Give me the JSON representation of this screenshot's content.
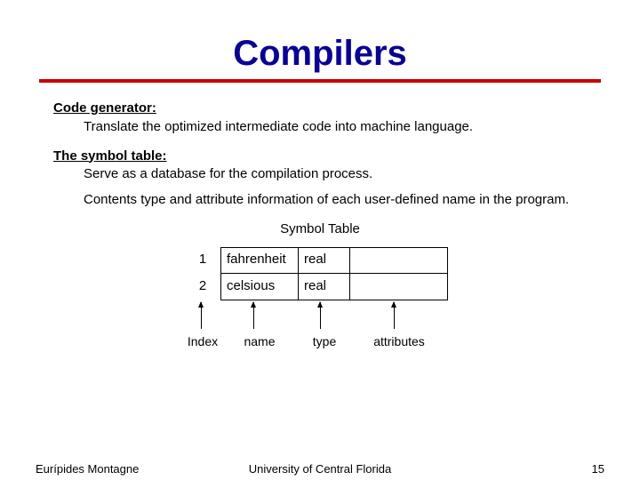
{
  "title": "Compilers",
  "sections": {
    "codegen": {
      "head": "Code generator:",
      "body": "Translate the optimized intermediate code into machine language."
    },
    "symtab": {
      "head": "The symbol table:",
      "body1": "Serve as a database for the compilation process.",
      "body2": "Contents type and attribute information of each user-defined name in the program."
    }
  },
  "table_title": "Symbol Table",
  "table": {
    "rows": [
      {
        "index": "1",
        "name": "fahrenheit",
        "type": "real",
        "attr": ""
      },
      {
        "index": "2",
        "name": "celsious",
        "type": "real",
        "attr": ""
      }
    ],
    "labels": {
      "index": "Index",
      "name": "name",
      "type": "type",
      "attr": "attributes"
    }
  },
  "footer": {
    "left": "Eurípides Montagne",
    "center": "University of Central Florida",
    "right": "15"
  }
}
